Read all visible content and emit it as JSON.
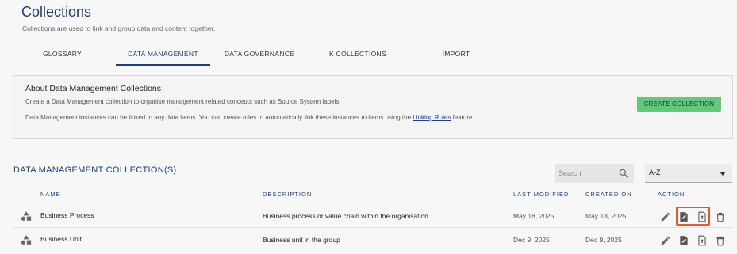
{
  "header": {
    "title": "Collections",
    "subtitle": "Collections are used to link and group data and content together."
  },
  "tabs": [
    {
      "label": "GLOSSARY",
      "active": false
    },
    {
      "label": "DATA MANAGEMENT",
      "active": true
    },
    {
      "label": "DATA GOVERNANCE",
      "active": false
    },
    {
      "label": "K COLLECTIONS",
      "active": false
    },
    {
      "label": "IMPORT",
      "active": false
    }
  ],
  "about": {
    "title": "About Data Management Collections",
    "line1": "Create a Data Management collection to organise management related concepts such as Source System labels.",
    "line2_before": "Data Management instances can be linked to any data items. You can create rules to automatically link these instances to items using the ",
    "line2_link": "Linking Rules",
    "line2_after": " feature.",
    "create_button": "CREATE COLLECTION"
  },
  "list": {
    "title": "DATA MANAGEMENT COLLECTION(S)",
    "search_placeholder": "Search",
    "sort_value": "A-Z",
    "columns": {
      "name": "NAME",
      "description": "DESCRIPTION",
      "last_modified": "LAST MODIFIED",
      "created_on": "CREATED ON",
      "action": "ACTION"
    },
    "rows": [
      {
        "name": "Business Process",
        "description": "Business process or value chain within the organisation",
        "last_modified": "May 18, 2025",
        "created_on": "May 18, 2025"
      },
      {
        "name": "Business Unit",
        "description": "Business unit in the group",
        "last_modified": "Dec 9, 2025",
        "created_on": "Dec 9, 2025"
      }
    ]
  },
  "colors": {
    "primary": "#1f3d7a",
    "create_button": "#5fcb7a",
    "highlight": "#e4582b"
  },
  "icons": {
    "row_icon": "shapes-icon",
    "actions": [
      "pencil-icon",
      "edit-document-icon",
      "upload-file-icon",
      "trash-icon"
    ]
  }
}
